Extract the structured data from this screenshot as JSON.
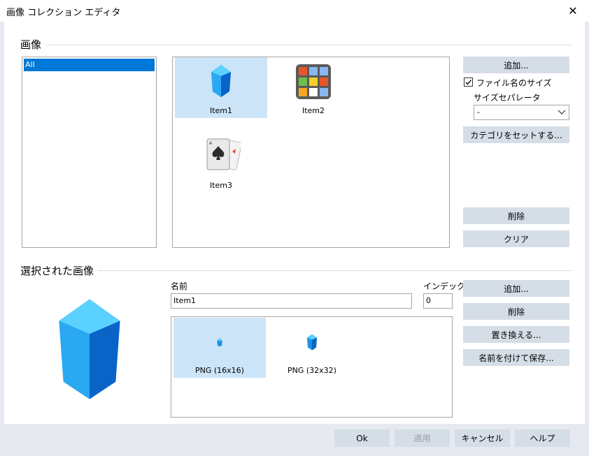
{
  "window": {
    "title": "画像 コレクション エディタ",
    "close_glyph": "✕"
  },
  "images_section": {
    "title": "画像",
    "categories": [
      {
        "label": "All",
        "selected": true
      }
    ],
    "items": [
      {
        "label": "Item1",
        "icon": "crystal-icon",
        "selected": true
      },
      {
        "label": "Item2",
        "icon": "color-grid-icon",
        "selected": false
      },
      {
        "label": "Item3",
        "icon": "playing-cards-icon",
        "selected": false
      }
    ]
  },
  "side_buttons": {
    "add": "追加...",
    "filename_size_checkbox": {
      "label": "ファイル名のサイズ",
      "checked": true
    },
    "size_separator_label": "サイズセパレータ",
    "size_separator_value": "-",
    "set_category": "カテゴリをセットする...",
    "delete": "削除",
    "clear": "クリア"
  },
  "selected_section": {
    "title": "選択された画像",
    "name_label": "名前",
    "name_value": "Item1",
    "index_label": "インデックス",
    "index_value": "0",
    "sizes": [
      {
        "label": "PNG (16x16)",
        "selected": true
      },
      {
        "label": "PNG (32x32)",
        "selected": false
      }
    ],
    "buttons": {
      "add": "追加...",
      "delete": "削除",
      "replace": "置き換える...",
      "save_as": "名前を付けて保存..."
    }
  },
  "footer": {
    "ok": "Ok",
    "apply": "適用",
    "cancel": "キャンセル",
    "help": "ヘルプ"
  },
  "colors": {
    "selection": "#0078d7",
    "tile_selection": "#cce4f7",
    "button_bg": "#d5dde6",
    "footer_bg": "#e6eaf0"
  }
}
